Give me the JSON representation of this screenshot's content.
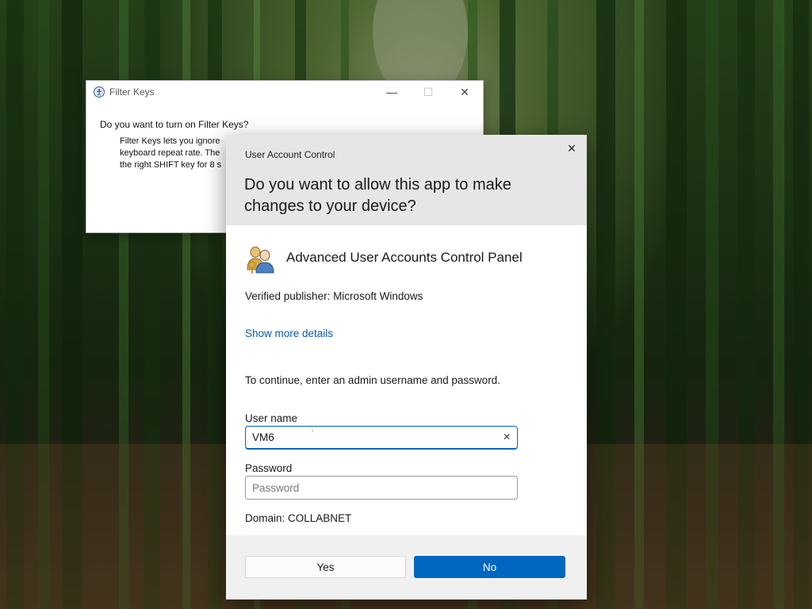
{
  "filter_keys_window": {
    "title": "Filter Keys",
    "question": "Do you want to turn on Filter Keys?",
    "body_lines": [
      "Filter Keys lets you ignore",
      "keyboard repeat rate.  The",
      "the right SHIFT key for 8 s"
    ],
    "controls": {
      "minimize": "—",
      "maximize": "☐",
      "close": "✕"
    }
  },
  "uac_dialog": {
    "title": "User Account Control",
    "close_glyph": "✕",
    "question": "Do you want to allow this app to make changes to your device?",
    "app_name": "Advanced User Accounts Control Panel",
    "publisher": "Verified publisher: Microsoft Windows",
    "more_details_link": "Show more details",
    "instructions": "To continue, enter an admin username and password.",
    "username": {
      "label": "User name",
      "value": "VM6",
      "clear_glyph": "✕"
    },
    "password": {
      "label": "Password",
      "value": "",
      "placeholder": "Password"
    },
    "domain": "Domain: COLLABNET",
    "yes_label": "Yes",
    "no_label": "No"
  },
  "colors": {
    "accent": "#0067c0",
    "link": "#0b5cad",
    "header_bg": "#e6e6e6",
    "footer_bg": "#f0f0f0"
  },
  "icons": {
    "filter_keys_app": "accessibility-icon",
    "uac_app": "users-keys-icon"
  }
}
